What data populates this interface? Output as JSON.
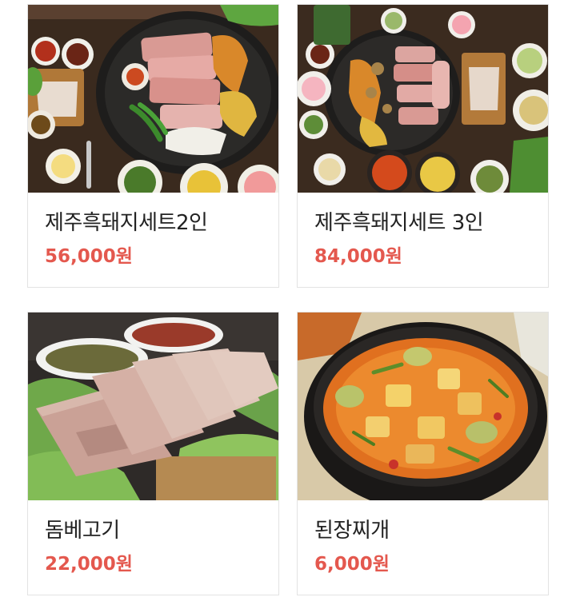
{
  "menu": {
    "items": [
      {
        "name": "제주흑돼지세트2인",
        "price": "56,000원",
        "photo": "bbq-set-2-photo"
      },
      {
        "name": "제주흑돼지세트 3인",
        "price": "84,000원",
        "photo": "bbq-set-3-photo"
      },
      {
        "name": "돔베고기",
        "price": "22,000원",
        "photo": "boiled-pork-photo"
      },
      {
        "name": "된장찌개",
        "price": "6,000원",
        "photo": "doenjang-stew-photo"
      }
    ]
  },
  "colors": {
    "price": "#e4584e",
    "name": "#222222",
    "border": "#e3e3e3"
  }
}
